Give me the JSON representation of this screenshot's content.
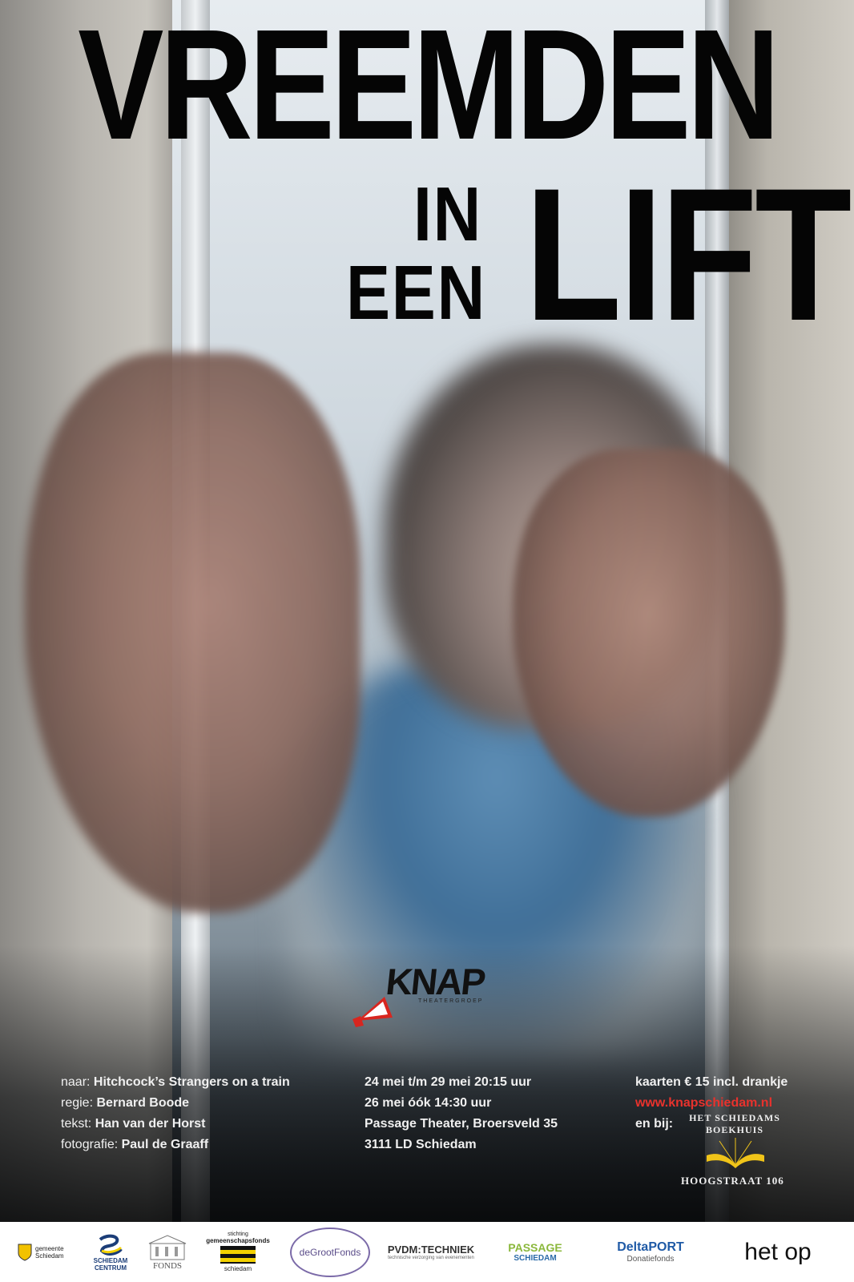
{
  "title": {
    "line1": "VREEMDEN",
    "in": "IN",
    "een": "EEN",
    "lift": "LIFT"
  },
  "logo": {
    "name": "KNAP",
    "subtitle": "THEATERGROEP"
  },
  "credits": [
    {
      "label": "naar:",
      "value": "Hitchcock’s Strangers on a train"
    },
    {
      "label": "regie:",
      "value": "Bernard Boode"
    },
    {
      "label": "tekst:",
      "value": "Han van der Horst"
    },
    {
      "label": "fotografie:",
      "value": "Paul de Graaff"
    }
  ],
  "dates": [
    "24 mei t/m 29 mei 20:15 uur",
    "26 mei óók 14:30 uur",
    "Passage Theater, Broersveld 35",
    "3111 LD  Schiedam"
  ],
  "tickets": {
    "price": "kaarten  € 15 incl. drankje",
    "url": "www.knapschiedam.nl",
    "also": "en bij:",
    "store_name": "HET SCHIEDAMS BOEKHUIS",
    "store_address": "HOOGSTRAAT 106"
  },
  "sponsors": {
    "gemeente": "gemeente Schiedam",
    "centrum_1": "SCHIEDAM",
    "centrum_2": "CENTRUM",
    "fonds": "FONDS",
    "gsfonds_1": "stichting",
    "gsfonds_2": "gemeenschapsfonds",
    "gsfonds_3": "schiedam",
    "degroot": "deGrootFonds",
    "pvdm_1": "PVDM:TECHNIEK",
    "pvdm_2": "technische verzorging van evenementen",
    "passage_1": "PASSAGE",
    "passage_2": "SCHIEDAM",
    "delta_1": "DeltaPORT",
    "delta_2": "Donatiefonds",
    "hetop": "het op"
  },
  "colors": {
    "title": "#050505",
    "url_red": "#e8322d",
    "text_light": "#f0f0f0"
  }
}
